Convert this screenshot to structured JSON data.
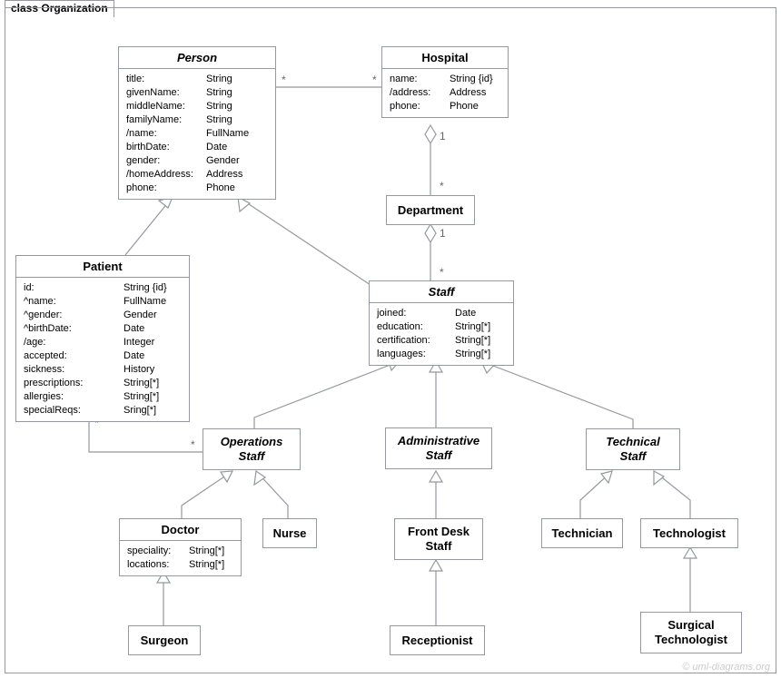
{
  "frame": {
    "title": "class Organization"
  },
  "watermark": "© uml-diagrams.org",
  "classes": {
    "person": {
      "name": "Person",
      "attrs": [
        {
          "k": "title:",
          "v": "String"
        },
        {
          "k": "givenName:",
          "v": "String"
        },
        {
          "k": "middleName:",
          "v": "String"
        },
        {
          "k": "familyName:",
          "v": "String"
        },
        {
          "k": "/name:",
          "v": "FullName"
        },
        {
          "k": "birthDate:",
          "v": "Date"
        },
        {
          "k": "gender:",
          "v": "Gender"
        },
        {
          "k": "/homeAddress:",
          "v": "Address"
        },
        {
          "k": "phone:",
          "v": "Phone"
        }
      ]
    },
    "hospital": {
      "name": "Hospital",
      "attrs": [
        {
          "k": "name:",
          "v": "String {id}"
        },
        {
          "k": "/address:",
          "v": "Address"
        },
        {
          "k": "phone:",
          "v": "Phone"
        }
      ]
    },
    "department": {
      "name": "Department"
    },
    "patient": {
      "name": "Patient",
      "attrs": [
        {
          "k": "id:",
          "v": "String {id}"
        },
        {
          "k": "^name:",
          "v": "FullName"
        },
        {
          "k": "^gender:",
          "v": "Gender"
        },
        {
          "k": "^birthDate:",
          "v": "Date"
        },
        {
          "k": "/age:",
          "v": "Integer"
        },
        {
          "k": "accepted:",
          "v": "Date"
        },
        {
          "k": "sickness:",
          "v": "History"
        },
        {
          "k": "prescriptions:",
          "v": "String[*]"
        },
        {
          "k": "allergies:",
          "v": "String[*]"
        },
        {
          "k": "specialReqs:",
          "v": "Sring[*]"
        }
      ]
    },
    "staff": {
      "name": "Staff",
      "attrs": [
        {
          "k": "joined:",
          "v": "Date"
        },
        {
          "k": "education:",
          "v": "String[*]"
        },
        {
          "k": "certification:",
          "v": "String[*]"
        },
        {
          "k": "languages:",
          "v": "String[*]"
        }
      ]
    },
    "operationsStaff": {
      "line1": "Operations",
      "line2": "Staff"
    },
    "adminStaff": {
      "line1": "Administrative",
      "line2": "Staff"
    },
    "techStaff": {
      "line1": "Technical",
      "line2": "Staff"
    },
    "doctor": {
      "name": "Doctor",
      "attrs": [
        {
          "k": "speciality:",
          "v": "String[*]"
        },
        {
          "k": "locations:",
          "v": "String[*]"
        }
      ]
    },
    "nurse": {
      "name": "Nurse"
    },
    "frontDesk": {
      "line1": "Front Desk",
      "line2": "Staff"
    },
    "technician": {
      "name": "Technician"
    },
    "technologist": {
      "name": "Technologist"
    },
    "surgeon": {
      "name": "Surgeon"
    },
    "receptionist": {
      "name": "Receptionist"
    },
    "surgicalTech": {
      "line1": "Surgical",
      "line2": "Technologist"
    }
  }
}
